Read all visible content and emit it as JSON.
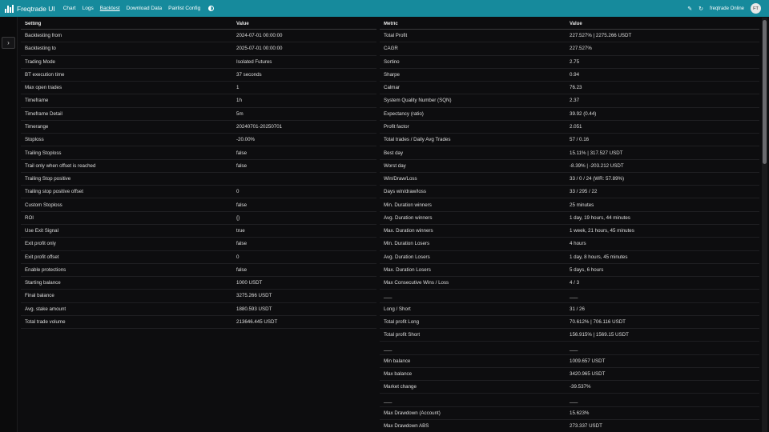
{
  "app": {
    "title": "Freqtrade UI"
  },
  "nav": {
    "links": [
      "Chart",
      "Logs",
      "Backtest",
      "Download Data",
      "Pairlist Config"
    ],
    "active_index": 2,
    "bot_name": "freqtrade",
    "status": "Online",
    "avatar_initials": "FT"
  },
  "left_table": {
    "headers": [
      "Setting",
      "Value"
    ],
    "rows": [
      [
        "Backtesting from",
        "2024-07-01 00:00:00"
      ],
      [
        "Backtesting to",
        "2025-07-01 00:00:00"
      ],
      [
        "Trading Mode",
        "Isolated Futures"
      ],
      [
        "BT execution time",
        "37 seconds"
      ],
      [
        "Max open trades",
        "1"
      ],
      [
        "Timeframe",
        "1h"
      ],
      [
        "Timeframe Detail",
        "5m"
      ],
      [
        "Timerange",
        "20240701-20250701"
      ],
      [
        "Stoploss",
        "-20.00%"
      ],
      [
        "Trailing Stoploss",
        "false"
      ],
      [
        "Trail only when offset is reached",
        "false"
      ],
      [
        "Trailing Stop positive",
        ""
      ],
      [
        "Trailing stop positive offset",
        "0"
      ],
      [
        "Custom Stoploss",
        "false"
      ],
      [
        "ROI",
        "{}"
      ],
      [
        "Use Exit Signal",
        "true"
      ],
      [
        "Exit profit only",
        "false"
      ],
      [
        "Exit profit offset",
        "0"
      ],
      [
        "Enable protections",
        "false"
      ],
      [
        "Starting balance",
        "1000 USDT"
      ],
      [
        "Final balance",
        "3275.266 USDT"
      ],
      [
        "Avg. stake amount",
        "1880.593 USDT"
      ],
      [
        "Total trade volume",
        "213646.445 USDT"
      ]
    ]
  },
  "right_table": {
    "headers": [
      "Metric",
      "Value"
    ],
    "rows": [
      [
        "Total Profit",
        "227.527% | 2275.266 USDT"
      ],
      [
        "CAGR",
        "227.527%"
      ],
      [
        "Sortino",
        "2.75"
      ],
      [
        "Sharpe",
        "0.94"
      ],
      [
        "Calmar",
        "76.23"
      ],
      [
        "System Quality Number (SQN)",
        "2.37"
      ],
      [
        "Expectancy (ratio)",
        "39.92 (0.44)"
      ],
      [
        "Profit factor",
        "2.051"
      ],
      [
        "Total trades / Daily Avg Trades",
        "57 / 0.16"
      ],
      [
        "Best day",
        "15.11% | 317.527 USDT"
      ],
      [
        "Worst day",
        "-8.39% | -203.212 USDT"
      ],
      [
        "Win/Draw/Loss",
        "33 / 0 / 24 (WR: 57.89%)"
      ],
      [
        "Days win/draw/loss",
        "33 / 295 / 22"
      ],
      [
        "Min. Duration winners",
        "25 minutes"
      ],
      [
        "Avg. Duration winners",
        "1 day, 19 hours, 44 minutes"
      ],
      [
        "Max. Duration winners",
        "1 week, 21 hours, 45 minutes"
      ],
      [
        "Min. Duration Losers",
        "4 hours"
      ],
      [
        "Avg. Duration Losers",
        "1 day, 8 hours, 45 minutes"
      ],
      [
        "Max. Duration Losers",
        "5 days, 6 hours"
      ],
      [
        "Max Consecutive Wins / Loss",
        "4 / 3"
      ],
      [
        "___",
        "___"
      ],
      [
        "Long / Short",
        "31 / 26"
      ],
      [
        "Total profit Long",
        "70.612% | 706.116 USDT"
      ],
      [
        "Total profit Short",
        "156.915% | 1569.15 USDT"
      ],
      [
        "___",
        "___"
      ],
      [
        "Min balance",
        "1009.657 USDT"
      ],
      [
        "Max balance",
        "3420.965 USDT"
      ],
      [
        "Market change",
        "-39.537%"
      ],
      [
        "___",
        "___"
      ],
      [
        "Max Drawdown (Account)",
        "15.623%"
      ],
      [
        "Max Drawdown ABS",
        "273.337 USDT"
      ]
    ]
  }
}
